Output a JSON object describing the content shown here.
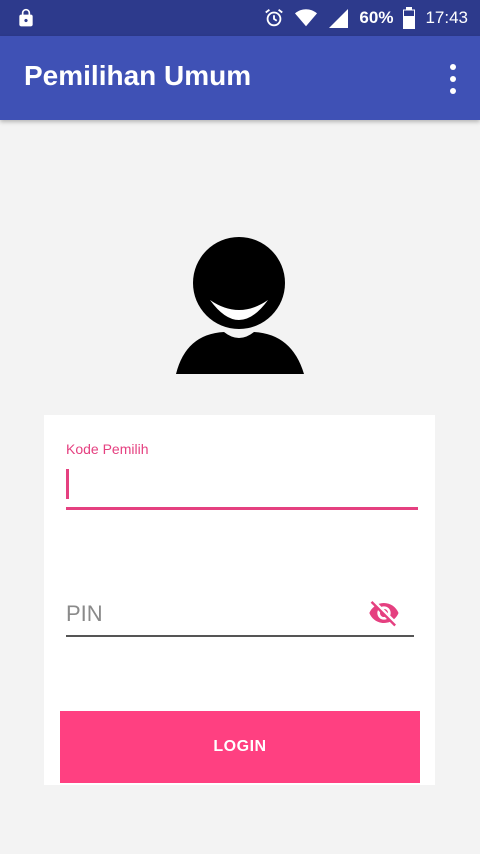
{
  "status_bar": {
    "battery_percent": "60%",
    "time": "17:43",
    "icons": [
      "lock-icon",
      "alarm-icon",
      "wifi-icon",
      "signal-icon",
      "battery-icon"
    ]
  },
  "app_bar": {
    "title": "Pemilihan Umum",
    "menu_icon": "overflow-menu-icon"
  },
  "form": {
    "voter_code_label": "Kode Pemilih",
    "voter_code_value": "",
    "pin_placeholder": "PIN",
    "pin_value": "",
    "pin_visibility_icon": "eye-off-icon",
    "login_label": "LOGIN"
  },
  "colors": {
    "status_bar": "#2d3a8c",
    "app_bar": "#3f51b5",
    "accent": "#ff4081",
    "label_accent": "#e54080",
    "background": "#f3f3f3"
  }
}
